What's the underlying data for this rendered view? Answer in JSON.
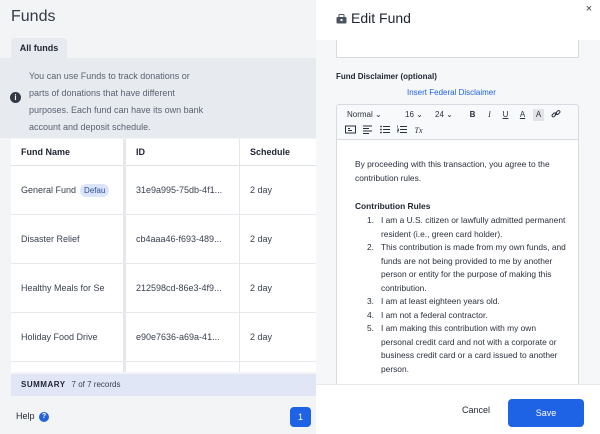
{
  "page": {
    "title": "Funds",
    "tab_all": "All funds",
    "info_text": "You can use Funds to track donations or parts of donations that have different purposes. Each fund can have its own bank account and deposit schedule."
  },
  "table": {
    "headers": [
      "Fund Name",
      "ID",
      "Schedule"
    ],
    "rows": [
      {
        "name": "General Fund",
        "badge": "Defau",
        "id": "31e9a995-75db-4f1...",
        "schedule": "2 day"
      },
      {
        "name": "Disaster Relief",
        "badge": "",
        "id": "cb4aaa46-f693-489...",
        "schedule": "2 day"
      },
      {
        "name": "Healthy Meals for Se",
        "badge": "",
        "id": "212598cd-86e3-4f9...",
        "schedule": "2 day"
      },
      {
        "name": "Holiday Food Drive",
        "badge": "",
        "id": "e90e7636-a69a-41...",
        "schedule": "2 day"
      }
    ]
  },
  "summary": {
    "label": "SUMMARY",
    "count": "7 of 7 records"
  },
  "footer_left": {
    "help": "Help",
    "help_icon": "?",
    "page": "1"
  },
  "drawer": {
    "title": "Edit Fund",
    "close": "×",
    "field_label": "Fund Disclaimer (optional)",
    "insert_link": "Insert Federal Disclaimer",
    "toolbar": {
      "format": "Normal",
      "size1": "16",
      "size2": "24",
      "bold": "B",
      "italic": "I",
      "underline": "U",
      "color": "A",
      "highlight": "A",
      "clear": "Tx"
    },
    "editor": {
      "intro": "By proceeding with this transaction, you agree to the contribution rules.",
      "heading": "Contribution Rules",
      "items": [
        "I am a U.S. citizen or lawfully admitted permanent resident (i.e., green card holder).",
        "This contribution is made from my own funds, and funds are not being provided to me by another person or entity for the purpose of making this contribution.",
        "I am at least eighteen years old.",
        "I am not a federal contractor.",
        "I am making this contribution with my own personal credit card and not with a corporate or business credit card or a card issued to another person."
      ]
    },
    "cancel": "Cancel",
    "save": "Save"
  }
}
